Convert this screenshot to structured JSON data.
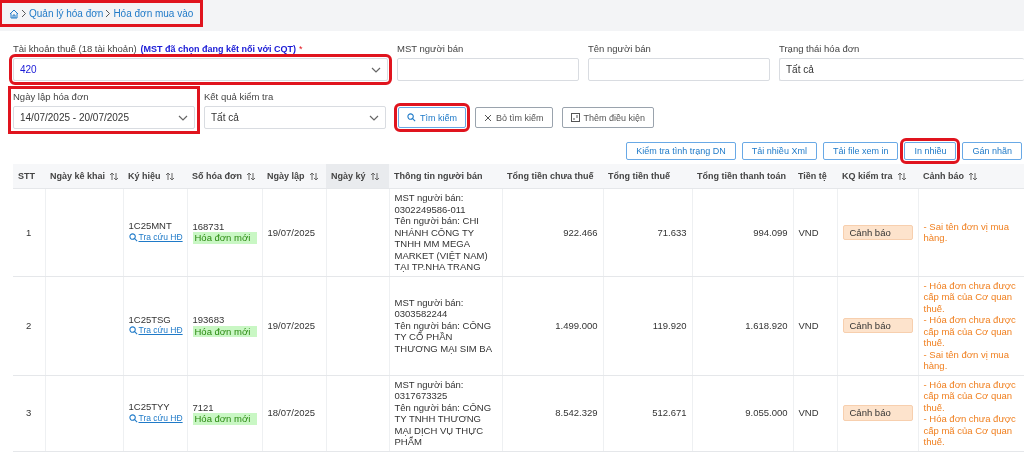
{
  "breadcrumb": {
    "highlighted": true,
    "items": [
      "Quản lý hóa đơn",
      "Hóa đơn mua vào"
    ]
  },
  "filters": {
    "tax_account": {
      "label": "Tài khoản thuế (18 tài khoản)",
      "note": "(MST đã chọn đang kết nối với CQT)",
      "required_mark": "*",
      "value": "420",
      "highlighted": true
    },
    "seller_tax_code": {
      "label": "MST người bán"
    },
    "seller_name": {
      "label": "Tên người bán"
    },
    "invoice_status": {
      "label": "Trạng thái hóa đơn",
      "value": "Tất cả"
    },
    "invoice_date": {
      "label": "Ngày lập hóa đơn",
      "value": "14/07/2025 - 20/07/2025",
      "highlighted": true
    },
    "check_result": {
      "label": "Kết quả kiểm tra",
      "value": "Tất cả"
    },
    "buttons": [
      {
        "label": "Tìm kiếm",
        "kind": "search",
        "highlighted": true
      },
      {
        "label": "Bỏ tìm kiếm",
        "kind": "clear",
        "highlighted": false
      },
      {
        "label": "Thêm điều kiện",
        "kind": "add",
        "highlighted": false
      }
    ]
  },
  "toolbar": [
    {
      "label": "Kiểm tra tình trạng DN",
      "highlighted": false
    },
    {
      "label": "Tải nhiều Xml",
      "highlighted": false
    },
    {
      "label": "Tải file xem in",
      "highlighted": false
    },
    {
      "label": "In nhiều",
      "highlighted": true
    },
    {
      "label": "Gán nhãn",
      "highlighted": false
    }
  ],
  "table": {
    "columns": [
      {
        "label": "STT",
        "sortable": false,
        "selected": false
      },
      {
        "label": "Ngày kê khai",
        "sortable": true,
        "selected": false
      },
      {
        "label": "Ký hiệu",
        "sortable": true,
        "selected": false
      },
      {
        "label": "Số hóa đơn",
        "sortable": true,
        "selected": false
      },
      {
        "label": "Ngày lập",
        "sortable": true,
        "selected": false
      },
      {
        "label": "Ngày ký",
        "sortable": true,
        "selected": true
      },
      {
        "label": "Thông tin người bán",
        "sortable": false,
        "selected": false
      },
      {
        "label": "Tổng tiền chưa thuế",
        "sortable": false,
        "selected": false
      },
      {
        "label": "Tổng tiền thuế",
        "sortable": false,
        "selected": false
      },
      {
        "label": "Tổng tiền thanh toán",
        "sortable": false,
        "selected": false
      },
      {
        "label": "Tiền tệ",
        "sortable": false,
        "selected": false
      },
      {
        "label": "KQ kiểm tra",
        "sortable": true,
        "selected": false
      },
      {
        "label": "Cảnh báo",
        "sortable": true,
        "selected": false
      }
    ],
    "rows": [
      {
        "stt": "1",
        "symbol": "1C25MNT",
        "lookup": "Tra cứu HĐ",
        "number": "168731",
        "status": "Hóa đơn mới",
        "date": "19/07/2025",
        "seller_tax_label": "MST người bán:",
        "seller_tax": "0302249586-011",
        "seller_name": "Tên người bán: CHI NHÁNH CÔNG TY TNHH MM MEGA MARKET (VIỆT NAM) TẠI TP.NHA TRANG",
        "subtotal": "922.466",
        "tax": "71.633",
        "total": "994.099",
        "currency": "VND",
        "result": "Cảnh báo",
        "warnings": [
          "- Sai tên đơn vị mua hàng."
        ]
      },
      {
        "stt": "2",
        "symbol": "1C25TSG",
        "lookup": "Tra cứu HĐ",
        "number": "193683",
        "status": "Hóa đơn mới",
        "date": "19/07/2025",
        "seller_tax_label": "MST người bán:",
        "seller_tax": "0303582244",
        "seller_name": "Tên người bán: CÔNG TY CỔ PHẦN THƯƠNG MẠI SIM BA",
        "subtotal": "1.499.000",
        "tax": "119.920",
        "total": "1.618.920",
        "currency": "VND",
        "result": "Cảnh báo",
        "warnings": [
          "- Hóa đơn chưa được cấp mã của Cơ quan thuế.",
          "- Hóa đơn chưa được cấp mã của Cơ quan thuế.",
          "- Sai tên đơn vị mua hàng."
        ]
      },
      {
        "stt": "3",
        "symbol": "1C25TYY",
        "lookup": "Tra cứu HĐ",
        "number": "7121",
        "status": "Hóa đơn mới",
        "date": "18/07/2025",
        "seller_tax_label": "MST người bán:",
        "seller_tax": "0317673325",
        "seller_name": "Tên người bán: CÔNG TY TNHH THƯƠNG MẠI DỊCH VỤ THỰC PHẨM",
        "subtotal": "8.542.329",
        "tax": "512.671",
        "total": "9.055.000",
        "currency": "VND",
        "result": "Cảnh báo",
        "warnings": [
          "- Hóa đơn chưa được cấp mã của Cơ quan thuế.",
          "- Hóa đơn chưa được cấp mã của Cơ quan thuế."
        ]
      }
    ]
  }
}
